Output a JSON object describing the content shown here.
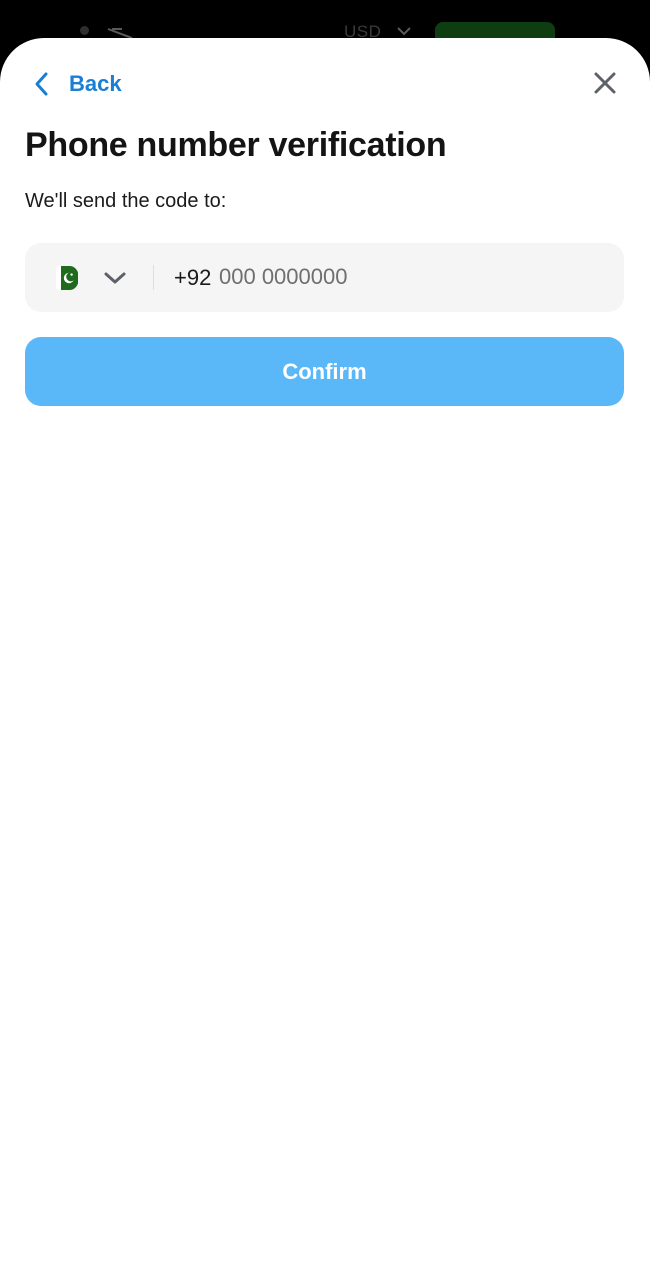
{
  "background_app": {
    "currency": "USD",
    "icons": [
      "dot-icon",
      "muted-icon",
      "chevron-down-icon"
    ]
  },
  "nav": {
    "back_label": "Back",
    "back_icon": "chevron-left-icon",
    "close_icon": "close-icon"
  },
  "page": {
    "title": "Phone number verification",
    "subtitle": "We'll send the code to:"
  },
  "phone": {
    "country_flag": "pakistan-flag-icon",
    "dial_code": "+92",
    "placeholder": "000 0000000",
    "value": ""
  },
  "actions": {
    "confirm_label": "Confirm"
  },
  "colors": {
    "accent": "#1a7fd4",
    "confirm_button": "#5bb8f8",
    "field_background": "#f5f5f5",
    "flag_green": "#1f6a1d"
  }
}
